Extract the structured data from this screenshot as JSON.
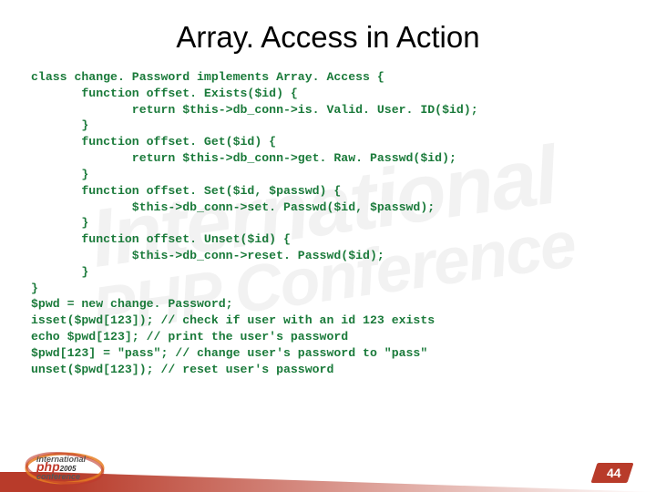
{
  "title": "Array. Access in Action",
  "code": "class change. Password implements Array. Access {\n       function offset. Exists($id) {\n              return $this->db_conn->is. Valid. User. ID($id);\n       }\n       function offset. Get($id) {\n              return $this->db_conn->get. Raw. Passwd($id);\n       }\n       function offset. Set($id, $passwd) {\n              $this->db_conn->set. Passwd($id, $passwd);\n       }\n       function offset. Unset($id) {\n              $this->db_conn->reset. Passwd($id);\n       }\n}\n$pwd = new change. Password;\nisset($pwd[123]); // check if user with an id 123 exists\necho $pwd[123]; // print the user's password\n$pwd[123] = \"pass\"; // change user's password to \"pass\"\nunset($pwd[123]); // reset user's password",
  "watermark_line1": "International",
  "watermark_line2": "PHP Conference",
  "logo": {
    "line1": "international",
    "line2": "php",
    "year": "2005",
    "line3": "conference"
  },
  "page_number": "44"
}
